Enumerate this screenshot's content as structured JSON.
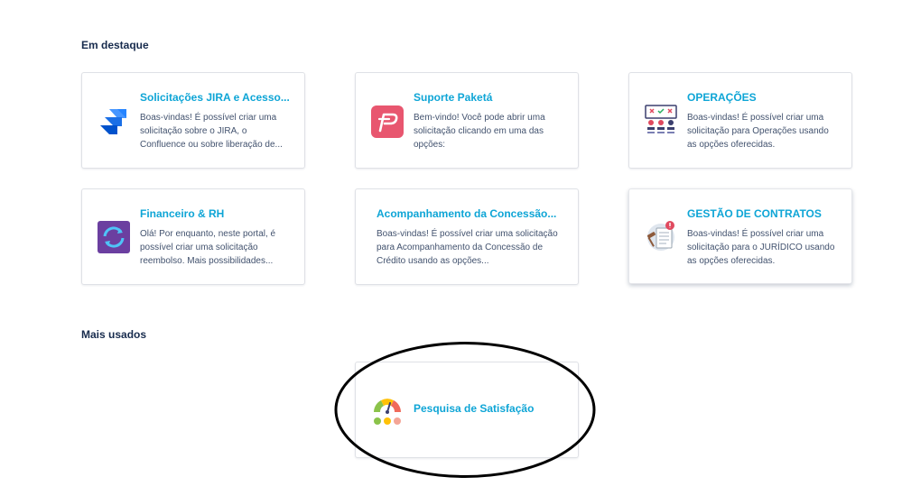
{
  "featured": {
    "heading": "Em destaque",
    "cards": [
      {
        "title": "Solicitações JIRA e Acesso...",
        "description": "Boas-vindas! É possível criar uma solicitação sobre o JIRA, o Confluence ou sobre liberação de...",
        "icon": "jira-logo-icon"
      },
      {
        "title": "Suporte Paketá",
        "description": "Bem-vindo! Você pode abrir uma solicitação clicando em uma das opções:",
        "icon": "paketa-logo-icon"
      },
      {
        "title": "OPERAÇÕES",
        "description": "Boas-vindas! É possível criar uma solicitação para Operações usando as opções oferecidas.",
        "icon": "operations-icon"
      },
      {
        "title": "Financeiro & RH",
        "description": "Olá! Por enquanto, neste portal, é possível criar uma solicitação reembolso. Mais possibilidades...",
        "icon": "refund-icon"
      },
      {
        "title": "Acompanhamento da Concessão...",
        "description": "Boas-vindas! É possível criar uma solicitação para Acompanhamento da Concessão de Crédito usando as opções...",
        "icon": ""
      },
      {
        "title": "GESTÃO DE CONTRATOS",
        "description": "Boas-vindas! É possível criar uma solicitação para o JURÍDICO usando as opções oferecidas.",
        "icon": "contract-icon"
      }
    ]
  },
  "most_used": {
    "heading": "Mais usados",
    "cards": [
      {
        "title": "Pesquisa de Satisfação",
        "icon": "satisfaction-gauge-icon"
      }
    ]
  },
  "colors": {
    "link": "#0ea5d6",
    "heading": "#172b4d",
    "annotation": "#000000"
  }
}
